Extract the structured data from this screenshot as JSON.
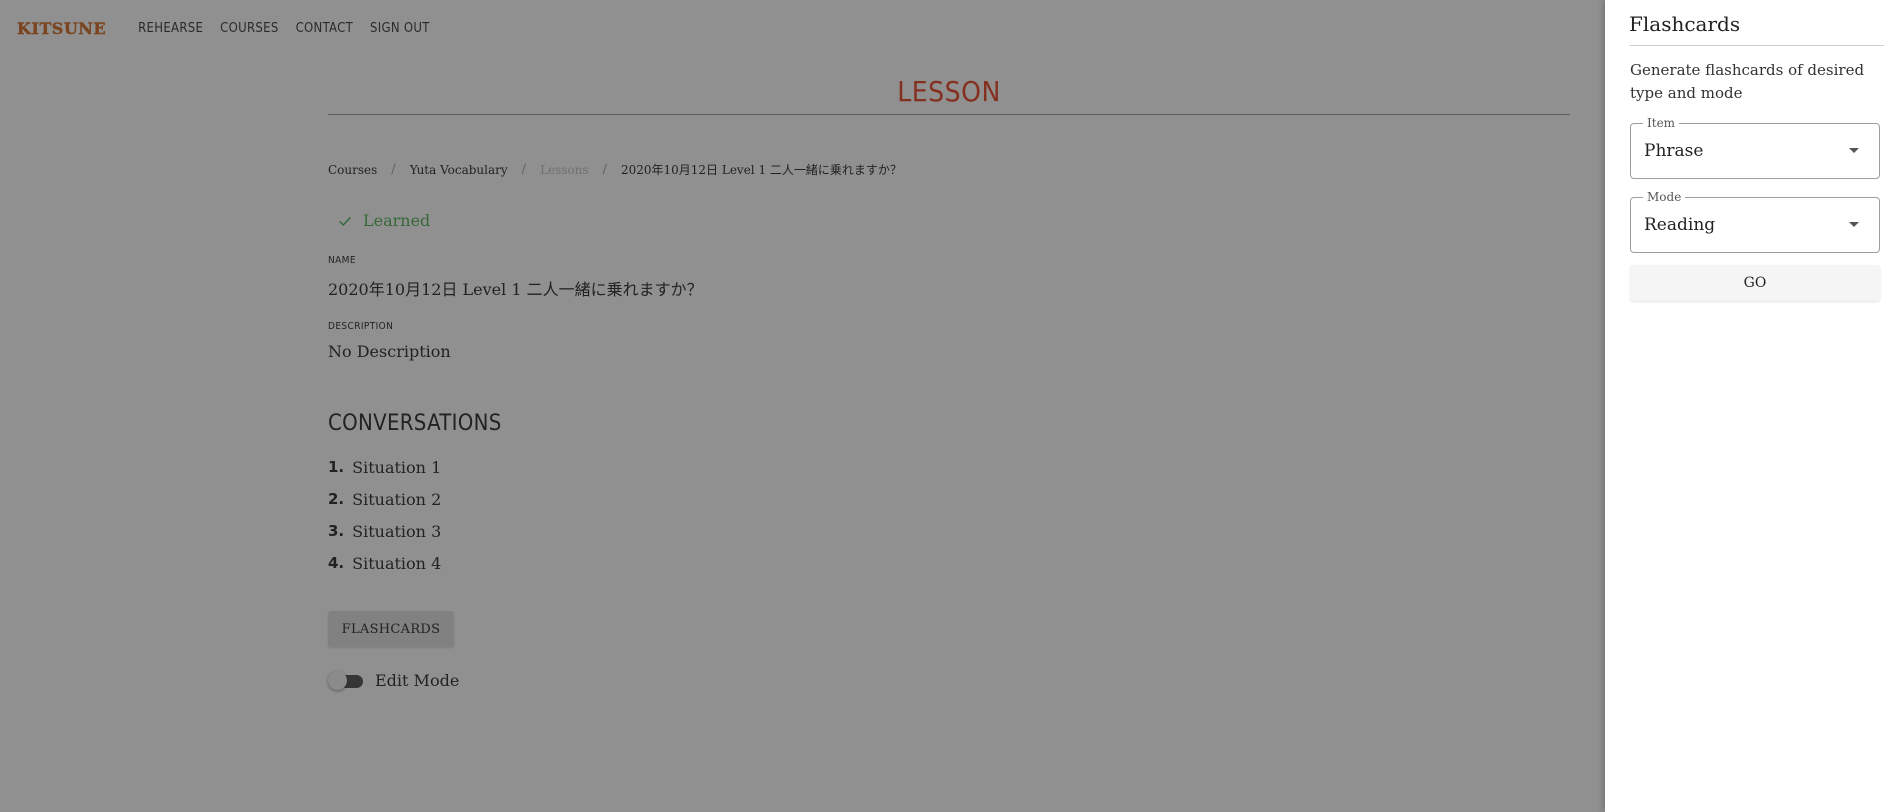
{
  "nav": {
    "logo": "KITSUNE",
    "links": [
      "REHEARSE",
      "COURSES",
      "CONTACT",
      "SIGN OUT"
    ]
  },
  "lesson": {
    "heading": "LESSON",
    "breadcrumb": [
      "Courses",
      "Yuta Vocabulary",
      "Lessons",
      "2020年10月12日 Level 1 二人一緒に乗れますか？"
    ],
    "breadcrumb_separator": "/",
    "learned_label": "Learned",
    "name_label": "NAME",
    "name_value": "2020年10月12日 Level 1 二人一緒に乗れますか？",
    "description_label": "DESCRIPTION",
    "description_value": "No Description",
    "conversations_title": "CONVERSATIONS",
    "conversations": [
      {
        "num": "1.",
        "label": "Situation 1"
      },
      {
        "num": "2.",
        "label": "Situation 2"
      },
      {
        "num": "3.",
        "label": "Situation 3"
      },
      {
        "num": "4.",
        "label": "Situation 4"
      }
    ],
    "flashcards_button": "FLASHCARDS",
    "edit_mode_label": "Edit Mode",
    "edit_mode_on": false
  },
  "drawer": {
    "title": "Flashcards",
    "description": "Generate flashcards of desired type and mode",
    "item_label": "Item",
    "item_value": "Phrase",
    "mode_label": "Mode",
    "mode_value": "Reading",
    "go_button": "GO"
  },
  "colors": {
    "logo": "#d2691e",
    "heading": "#e83c1c",
    "learned": "#4caf50",
    "overlay": "rgba(33,33,33,0.5)"
  },
  "icons": {
    "learned": "check-icon",
    "select": "caret-down-icon"
  }
}
